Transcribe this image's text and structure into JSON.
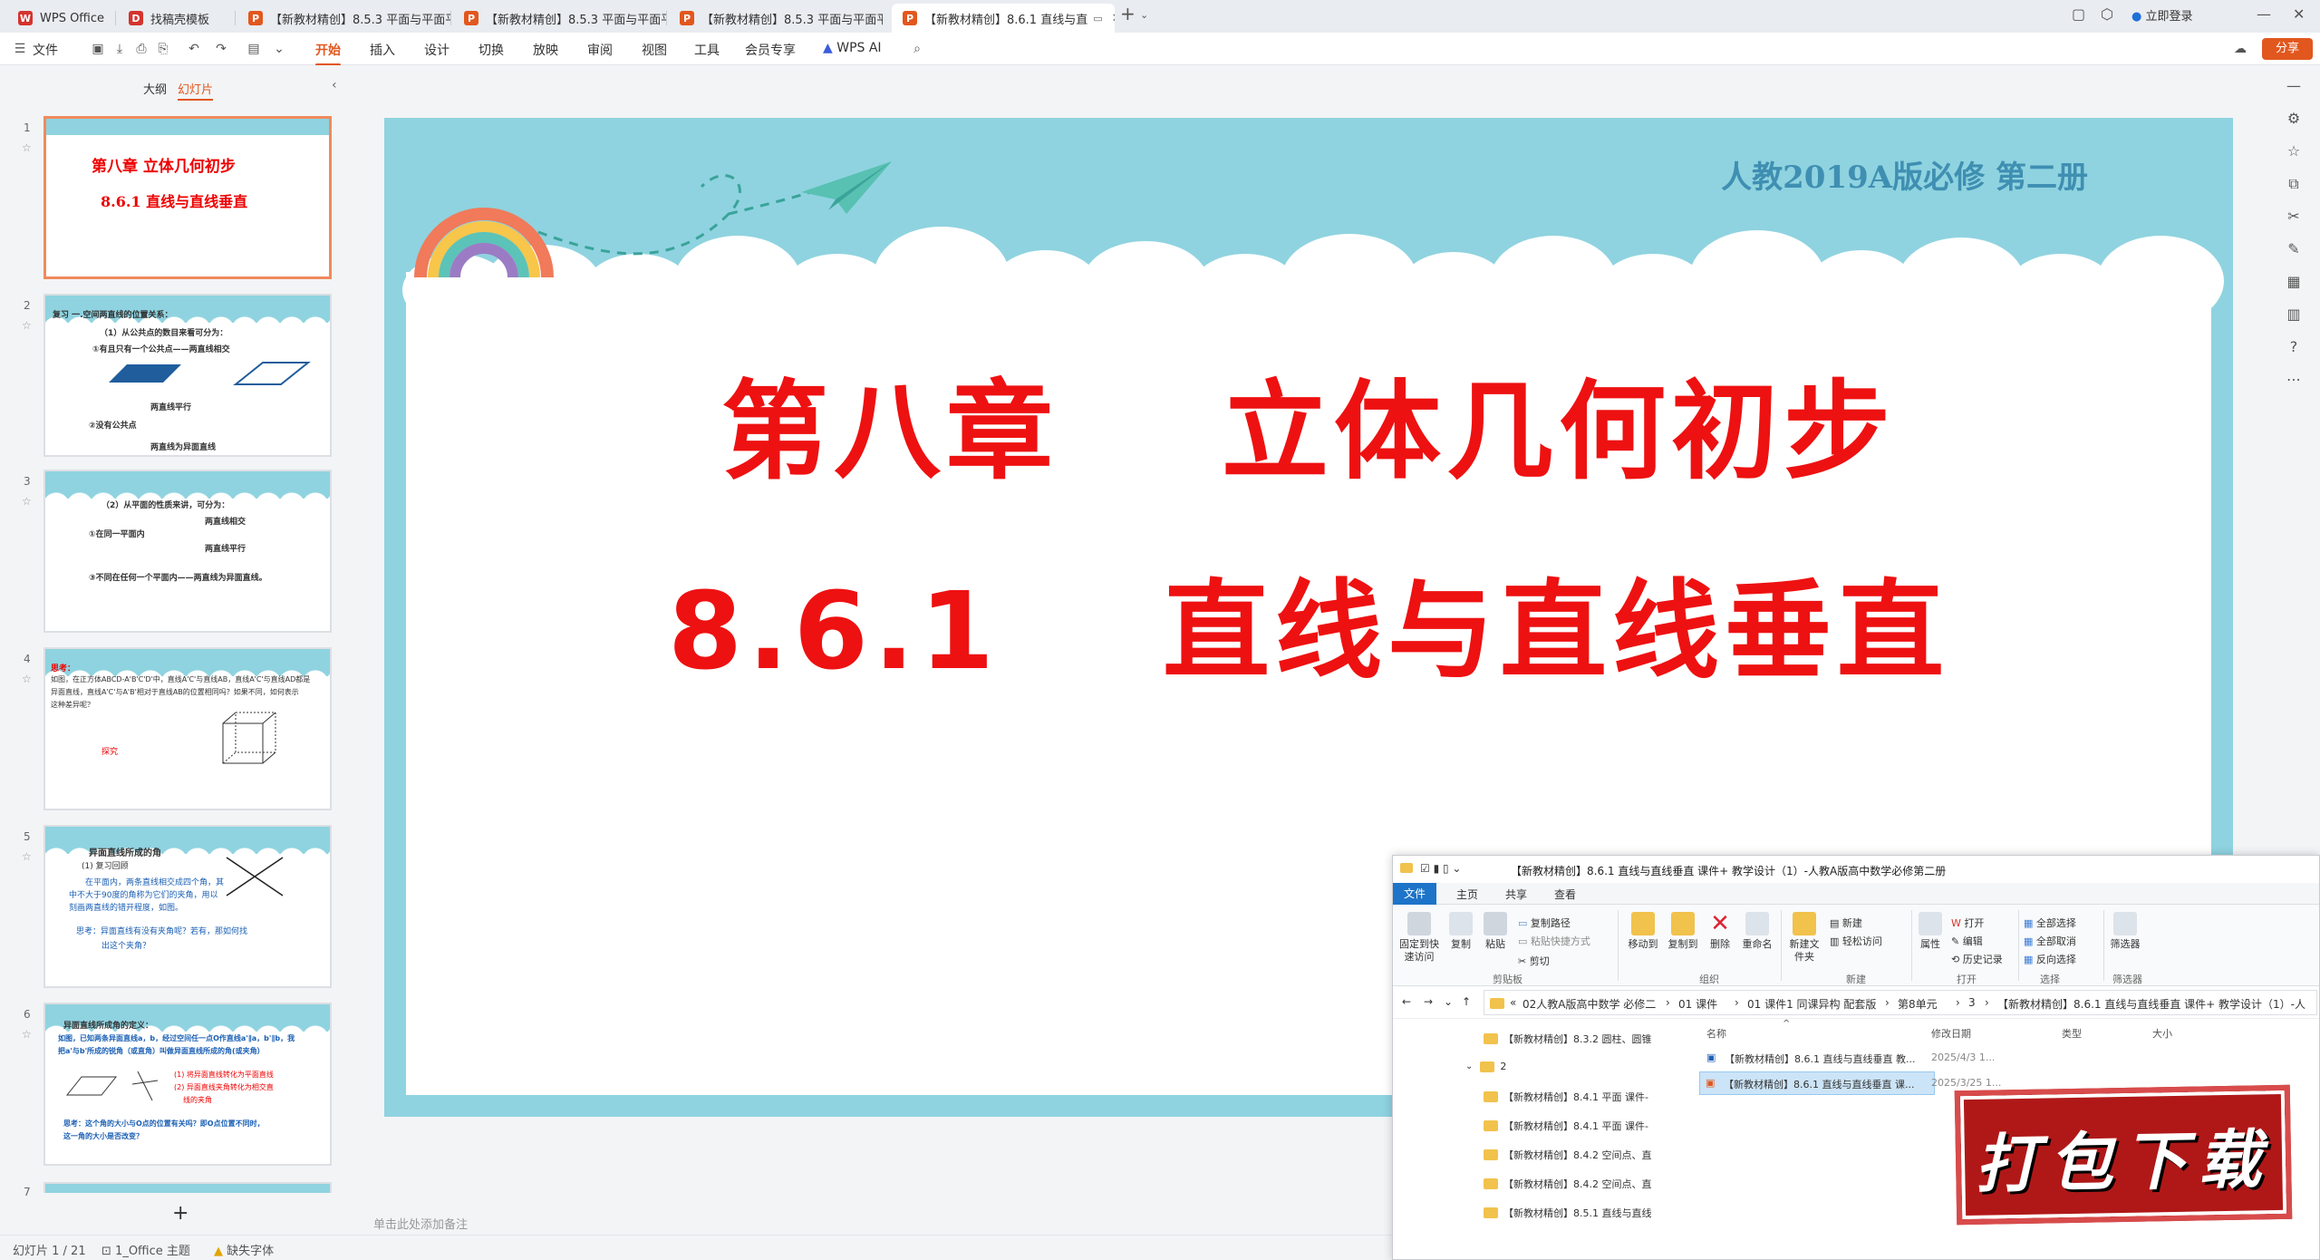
{
  "tabs": [
    {
      "label": "WPS Office",
      "icon": "W",
      "color": "#d4342e"
    },
    {
      "label": "找稿壳模板",
      "icon": "D",
      "color": "#d4342e"
    },
    {
      "label": "【新教材精创】8.5.3 平面与平面平行",
      "icon": "P",
      "color": "#e2571e"
    },
    {
      "label": "【新教材精创】8.5.3 平面与平面平行",
      "icon": "P",
      "color": "#e2571e"
    },
    {
      "label": "【新教材精创】8.5.3 平面与平面平行",
      "icon": "P",
      "color": "#e2571e"
    },
    {
      "label": "【新教材精创】8.6.1 直线与直",
      "icon": "P",
      "color": "#e2571e"
    }
  ],
  "titlebar": {
    "login": "立即登录",
    "new_tab": "+"
  },
  "menu": {
    "file": "文件",
    "items": [
      "开始",
      "插入",
      "设计",
      "切换",
      "放映",
      "审阅",
      "视图",
      "工具",
      "会员专享",
      "WPS AI"
    ],
    "active": "开始",
    "share": "分享"
  },
  "leftpanel": {
    "tab_outline": "大纲",
    "tab_slides": "幻灯片",
    "slides": [
      {
        "num": "1",
        "lines": [
          "第八章      立体几何初步",
          "8.6.1      直线与直线垂直"
        ]
      },
      {
        "num": "2",
        "lines": [
          "复习    一.空间两直线的位置关系：",
          "（1）从公共点的数目来看可分为：",
          "①有且只有一个公共点——两直线相交",
          "两直线平行",
          "②没有公共点",
          "两直线为异面直线"
        ]
      },
      {
        "num": "3",
        "lines": [
          "（2）从平面的性质来讲，可分为：",
          "两直线相交",
          "①在同一平面内",
          "两直线平行",
          "③不同在任何一个平面内——两直线为异面直线。"
        ]
      },
      {
        "num": "4",
        "lines": [
          "思考：",
          "如图，在正方体ABCD-A'B'C'D'中，直线A'C'与直线AB，直线A'C'与直线AD都是",
          "异面直线，直线A'C'与A'B'相对于直线AB的位置相同吗？如果不同，如何表示",
          "这种差异呢？",
          "探究"
        ]
      },
      {
        "num": "5",
        "lines": [
          "异面直线所成的角",
          "(1) 复习回顾",
          "在平面内，两条直线相交成四个角，其",
          "中不大于90度的角称为它们的夹角，用以",
          "刻画两直线的错开程度，如图。",
          "思考：异面直线有没有夹角呢？若有，那如何找",
          "出这个夹角？"
        ]
      },
      {
        "num": "6",
        "lines": [
          "异面直线所成角的定义：",
          "如图，已知两条异面直线a，b，经过空间任一点O作直线a'∥a，b'∥b，我",
          "把a'与b'所成的锐角（或直角）叫做异面直线所成的角(或夹角）",
          "(1) 将异面直线转化为平面直线",
          "(2) 异面直线夹角转化为相交直",
          "线的夹角",
          "思考：这个角的大小与O点的位置有关吗？即O点位置不同时，",
          "这一角的大小是否改变？"
        ]
      },
      {
        "num": "7",
        "lines": []
      }
    ],
    "add": "+"
  },
  "slide": {
    "subtitle": "人教2019A版必修 第二册",
    "title_a": "第八章",
    "title_b": "立体几何初步",
    "section_a": "8.6.1",
    "section_b": "直线与直线垂直",
    "notes_placeholder": "单击此处添加备注"
  },
  "statusbar": {
    "slide_count": "幻灯片 1 / 21",
    "theme": "1_Office 主题",
    "missing_font": "缺失字体"
  },
  "explorer": {
    "title": "【新教材精创】8.6.1 直线与直线垂直 课件+ 教学设计（1）-人教A版高中数学必修第二册",
    "ribbon_tabs": [
      "文件",
      "主页",
      "共享",
      "查看"
    ],
    "buttons": {
      "pin": "固定到快速访问",
      "copy": "复制",
      "paste": "粘贴",
      "copy_path": "复制路径",
      "paste_shortcut": "粘贴快捷方式",
      "cut": "剪切",
      "move_to": "移动到",
      "copy_to": "复制到",
      "delete": "删除",
      "rename": "重命名",
      "new_folder": "新建文件夹",
      "new_item": "新建",
      "easy_access": "轻松访问",
      "properties": "属性",
      "open": "打开",
      "edit": "编辑",
      "history": "历史记录",
      "select_all": "全部选择",
      "select_none": "全部取消",
      "invert": "反向选择",
      "filter": "筛选器"
    },
    "groups": [
      "剪贴板",
      "组织",
      "新建",
      "打开",
      "选择",
      "筛选器"
    ],
    "address": [
      "02人教A版高中数学 必修二",
      "01 课件",
      "01 课件1 同课异构 配套版",
      "第8单元",
      "3",
      "【新教材精创】8.6.1 直线与直线垂直 课件+ 教学设计（1）-人"
    ],
    "nav": [
      "【新教材精创】8.3.2 圆柱、圆锥",
      "2",
      "【新教材精创】8.4.1 平面 课件-",
      "【新教材精创】8.4.1 平面 课件-",
      "【新教材精创】8.4.2 空间点、直",
      "【新教材精创】8.4.2 空间点、直",
      "【新教材精创】8.5.1 直线与直线"
    ],
    "columns": [
      "名称",
      "修改日期",
      "类型",
      "大小"
    ],
    "files": [
      {
        "name": "【新教材精创】8.6.1 直线与直线垂直 教...",
        "date": "2025/4/3 1..."
      },
      {
        "name": "【新教材精创】8.6.1 直线与直线垂直 课...",
        "date": "2025/3/25 1..."
      }
    ]
  },
  "stamp": {
    "text": "打包下载"
  }
}
